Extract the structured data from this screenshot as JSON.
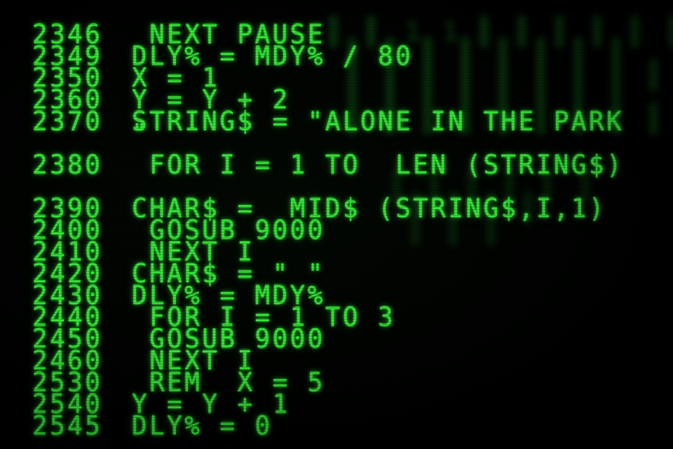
{
  "listing": [
    {
      "line": "2346",
      "code": " NEXT PAUSE"
    },
    {
      "line": "2349",
      "code": "DLY% = MDY% / 80"
    },
    {
      "line": "2350",
      "code": "X = 1"
    },
    {
      "line": "2360",
      "code": "Y = Y + 2"
    },
    {
      "line": "2370",
      "code": "STRING$ = \"ALONE IN THE PARK",
      "continuation": "\""
    },
    {
      "line": "2380",
      "code": " FOR I = 1 TO  LEN (STRING$)"
    },
    {
      "line": "2390",
      "code": "CHAR$ =  MID$ (STRING$,I,1)"
    },
    {
      "line": "2400",
      "code": " GOSUB 9000"
    },
    {
      "line": "2410",
      "code": " NEXT I"
    },
    {
      "line": "2420",
      "code": "CHAR$ = \" \""
    },
    {
      "line": "2430",
      "code": "DLY% = MDY%"
    },
    {
      "line": "2440",
      "code": " FOR I = 1 TO 3"
    },
    {
      "line": "2450",
      "code": " GOSUB 9000"
    },
    {
      "line": "2460",
      "code": " NEXT I"
    },
    {
      "line": "2530",
      "code": " REM  X = 5"
    },
    {
      "line": "2540",
      "code": "Y = Y + 1"
    },
    {
      "line": "2545",
      "code": "DLY% = 0"
    }
  ],
  "colors": {
    "phosphor": "#39e63a",
    "background": "#000000"
  }
}
